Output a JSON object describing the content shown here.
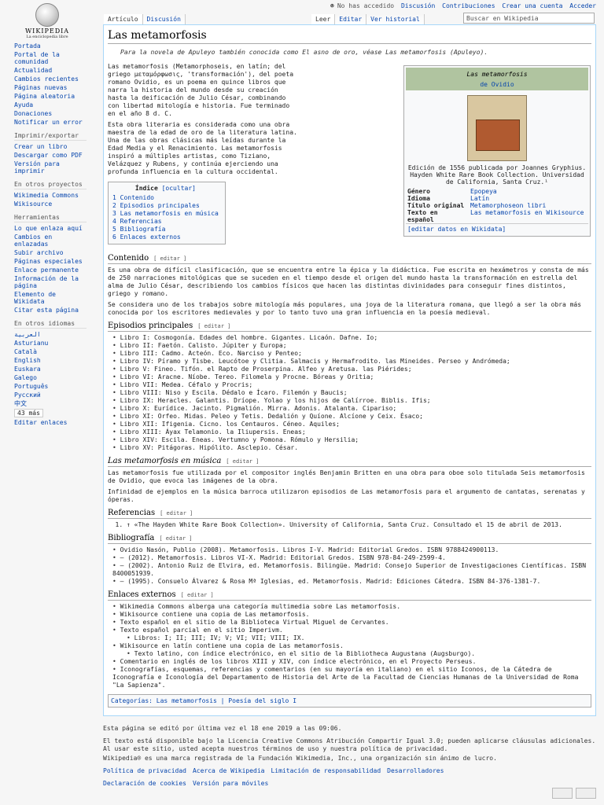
{
  "logo": {
    "name": "WIKIPEDIA",
    "tagline": "La enciclopedia libre"
  },
  "personal": {
    "notlogged": "No has accedido",
    "talk": "Discusión",
    "contribs": "Contribuciones",
    "create": "Crear una cuenta",
    "login": "Acceder"
  },
  "tabs": {
    "article": "Artículo",
    "talk": "Discusión",
    "read": "Leer",
    "edit": "Editar",
    "history": "Ver historial"
  },
  "search": {
    "placeholder": "Buscar en Wikipedia"
  },
  "sidebar": {
    "nav": [
      "Portada",
      "Portal de la comunidad",
      "Actualidad",
      "Cambios recientes",
      "Páginas nuevas",
      "Página aleatoria",
      "Ayuda",
      "Donaciones",
      "Notificar un error"
    ],
    "print_hd": "Imprimir/exportar",
    "print": [
      "Crear un libro",
      "Descargar como PDF",
      "Versión para imprimir"
    ],
    "other_hd": "En otros proyectos",
    "other": [
      "Wikimedia Commons",
      "Wikisource"
    ],
    "tools_hd": "Herramientas",
    "tools": [
      "Lo que enlaza aquí",
      "Cambios en enlazadas",
      "Subir archivo",
      "Páginas especiales",
      "Enlace permanente",
      "Información de la página",
      "Elemento de Wikidata",
      "Citar esta página"
    ],
    "lang_hd": "En otros idiomas",
    "langs": [
      "العربية",
      "Asturianu",
      "Català",
      "English",
      "Euskara",
      "Galego",
      "Português",
      "Русский",
      "中文"
    ],
    "more": "43 más",
    "editlinks": "Editar enlaces"
  },
  "article": {
    "title": "Las metamorfosis",
    "hatnote": "Para la novela de Apuleyo también conocida como El asno de oro, véase Las metamorfosis (Apuleyo).",
    "p1": "Las metamorfosis (Metamorphoseis, en latín; del griego μεταμόρφωσις, 'transformación'), del poeta romano Ovidio, es un poema en quince libros que narra la historia del mundo desde su creación hasta la deificación de Julio César, combinando con libertad mitología e historia. Fue terminado en el año 8 d. C.",
    "p2": "Esta obra literaria es considerada como una obra maestra de la edad de oro de la literatura latina. Una de las obras clásicas más leídas durante la Edad Media y el Renacimiento. Las metamorfosis inspiró a múltiples artistas, como Tiziano, Velázquez y Rubens, y continúa ejerciendo una profunda influencia en la cultura occidental."
  },
  "infobox": {
    "title": "Las metamorfosis",
    "author": "de Ovidio",
    "caption": "Edición de 1556 publicada por Joannes Gryphius. Hayden White Rare Book Collection. Universidad de California, Santa Cruz.¹",
    "rows": [
      {
        "k": "Género",
        "v": "Epopeya"
      },
      {
        "k": "Idioma",
        "v": "Latín"
      },
      {
        "k": "Título original",
        "v": "Metamorphoseon libri"
      },
      {
        "k": "Texto en español",
        "v": "Las metamorfosis en Wikisource"
      }
    ],
    "edit": "[editar datos en Wikidata]"
  },
  "toc": {
    "title": "Índice",
    "toggle": "[ocultar]",
    "items": [
      "1 Contenido",
      "2 Episodios principales",
      "3 Las metamorfosis en música",
      "4 Referencias",
      "5 Bibliografía",
      "6 Enlaces externos"
    ]
  },
  "edit_label": "[ editar ]",
  "s_contenido": {
    "h": "Contenido",
    "p1": "Es una obra de difícil clasificación, que se encuentra entre la épica y la didáctica. Fue escrita en hexámetros y consta de más de 250 narraciones mitológicas que se suceden en el tiempo desde el origen del mundo hasta la transformación en estrella del alma de Julio César, describiendo los cambios físicos que hacen las distintas divinidades para conseguir fines distintos, griego y romano.",
    "p2": "Se considera uno de los trabajos sobre mitología más populares, una joya de la literatura romana, que llegó a ser la obra más conocida por los escritores medievales y por lo tanto tuvo una gran influencia en la poesía medieval."
  },
  "s_episodios": {
    "h": "Episodios principales",
    "items": [
      "Libro I: Cosmogonía. Edades del hombre. Gigantes. Licaón. Dafne. Io;",
      "Libro II: Faetón. Calisto. Júpiter y Europa;",
      "Libro III: Cadmo. Acteón. Eco. Narciso y Penteo;",
      "Libro IV: Píramo y Tisbe. Leucótoe y Clitia. Salmacis y Hermafrodito. las Mineides. Perseo y Andrómeda;",
      "Libro V: Fineo. Tifón. el Rapto de Proserpina. Alfeo y Aretusa. las Piérides;",
      "Libro VI: Aracne. Níobe. Tereo. Filomela y Procne. Bóreas y Oritia;",
      "Libro VII: Medea. Céfalo y Procris;",
      "Libro VIII: Niso y Escila. Dédalo e Ícaro. Filemón y Baucis;",
      "Libro IX: Heracles. Galantis. Dríope. Yolao y los hijos de Calírroe. Biblis. Ifis;",
      "Libro X: Eurídice. Jacinto. Pigmalión. Mirra. Adonis. Atalanta. Cipariso;",
      "Libro XI: Orfeo. Midas. Peleo y Tetis. Dedalión y Quíone. Alcíone y Ceix. Ésaco;",
      "Libro XII: Ifigenia. Cicno. los Centauros. Céneo. Aquiles;",
      "Libro XIII: Áyax Telamonio. la Iliupersis. Eneas;",
      "Libro XIV: Escila. Eneas. Vertumno y Pomona. Rómulo y Hersilia;",
      "Libro XV: Pitágoras. Hipólito. Asclepio. César."
    ]
  },
  "s_musica": {
    "h": "Las metamorfosis en música",
    "p1": "Las metamorfosis fue utilizada por el compositor inglés Benjamin Britten en una obra para oboe solo titulada Seis metamorfosis de Ovidio, que evoca las imágenes de la obra.",
    "p2": "Infinidad de ejemplos en la música barroca utilizaron episodios de Las metamorfosis para el argumento de cantatas, serenatas y óperas."
  },
  "s_refs": {
    "h": "Referencias",
    "items": [
      "↑ «The Hayden White Rare Book Collection». University of California, Santa Cruz. Consultado el 15 de abril de 2013."
    ]
  },
  "s_biblio": {
    "h": "Bibliografía",
    "items": [
      "Ovidio Nasón, Publio (2008). Metamorfosis. Libros I-V. Madrid: Editorial Gredos. ISBN 9788424900113.",
      "— (2012). Metamorfosis. Libros VI-X. Madrid: Editorial Gredos. ISBN 978-84-249-2599-4.",
      "— (2002). Antonio Ruiz de Elvira, ed. Metamorfosis. Bilingüe. Madrid: Consejo Superior de Investigaciones Científicas. ISBN 8400051939.",
      "— (1995). Consuelo Álvarez & Rosa Mª Iglesias, ed. Metamorfosis. Madrid: Ediciones Cátedra. ISBN 84-376-1381-7."
    ]
  },
  "s_ext": {
    "h": "Enlaces externos",
    "items": [
      "Wikimedia Commons alberga una categoría multimedia sobre Las metamorfosis.",
      "Wikisource contiene una copia de Las metamorfosis.",
      "Texto español en el sitio de la Biblioteca Virtual Miguel de Cervantes.",
      "Texto español parcial en el sitio Imperivm.",
      "Wikisource en latín contiene una copia de Las metamorfosis.",
      "Comentario en inglés de los libros XIII y XIV, con índice electrónico, en el Proyecto Perseus.",
      "Iconografías, esquemas, referencias y comentarios (en su mayoría en italiano) en el sitio Iconos, de la Cátedra de Iconografía e Iconología del Departamento de Historia del Arte de la Facultad de Ciencias Humanas de la Universidad de Roma \"La Sapienza\"."
    ],
    "sub1": "Libros: I; II; III; IV; V; VI; VII; VIII; IX.",
    "sub2": "Texto latino, con índice electrónico, en el sitio de la Bibliotheca Augustana (Augsburgo)."
  },
  "cats": "Categorías: Las metamorfosis | Poesía del siglo I",
  "footer": {
    "edited": "Esta página se editó por última vez el 18 ene 2019 a las 09:06.",
    "license": "El texto está disponible bajo la Licencia Creative Commons Atribución Compartir Igual 3.0; pueden aplicarse cláusulas adicionales. Al usar este sitio, usted acepta nuestros términos de uso y nuestra política de privacidad.",
    "trademark": "Wikipedia® es una marca registrada de la Fundación Wikimedia, Inc., una organización sin ánimo de lucro.",
    "links": [
      "Política de privacidad",
      "Acerca de Wikipedia",
      "Limitación de responsabilidad",
      "Desarrolladores"
    ],
    "links2": [
      "Declaración de cookies",
      "Versión para móviles"
    ]
  }
}
